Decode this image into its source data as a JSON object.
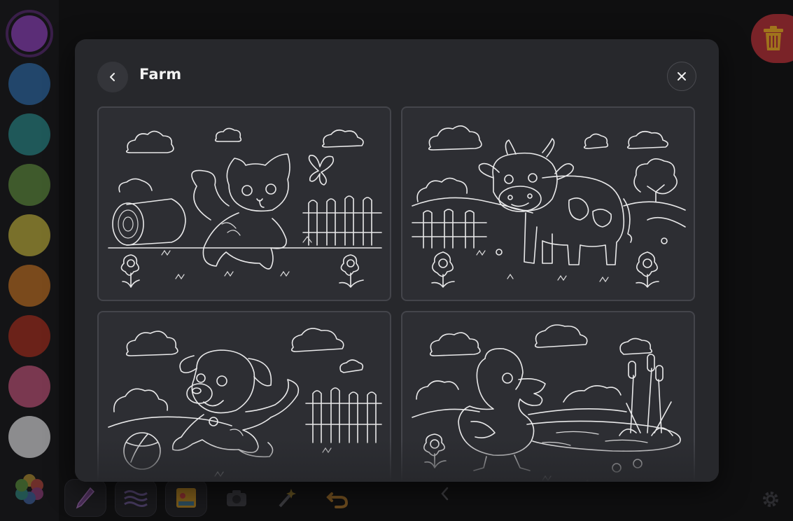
{
  "palette": {
    "colors": [
      "#5b2d77",
      "#22466b",
      "#1f5859",
      "#3f5a2c",
      "#79702b",
      "#7a4a1c",
      "#6b2219",
      "#7a3850",
      "#8c8c8e"
    ],
    "selected_index": 0
  },
  "modal": {
    "title": "Farm",
    "pages": [
      {
        "subject": "kitten"
      },
      {
        "subject": "cow"
      },
      {
        "subject": "puppy"
      },
      {
        "subject": "duckling"
      }
    ]
  },
  "toolbar": {
    "tools": [
      "pen-icon",
      "brush-icon",
      "sticker-icon",
      "camera-icon",
      "magic-wand-icon",
      "undo-icon"
    ]
  }
}
